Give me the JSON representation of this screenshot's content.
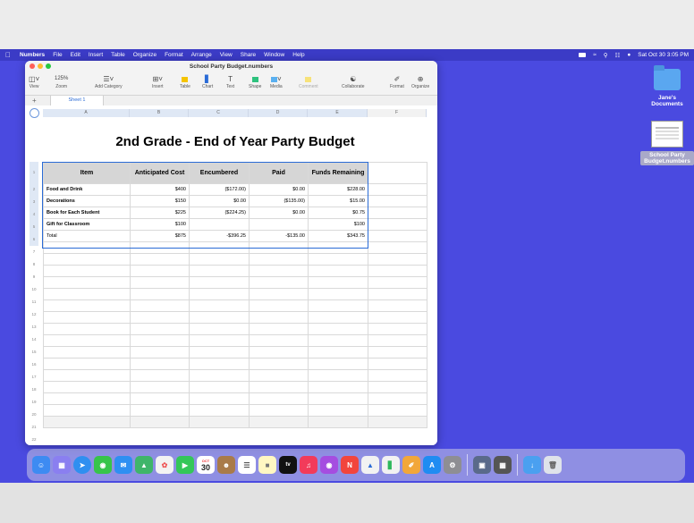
{
  "menubar": {
    "items": [
      "Numbers",
      "File",
      "Edit",
      "Insert",
      "Table",
      "Organize",
      "Format",
      "Arrange",
      "View",
      "Share",
      "Window",
      "Help"
    ],
    "datetime": "Sat Oct 30  3:05 PM"
  },
  "window": {
    "title": "School Party Budget.numbers",
    "toolbar": {
      "view": "View",
      "zoom_value": "125%",
      "zoom": "Zoom",
      "add_category": "Add Category",
      "insert": "Insert",
      "table": "Table",
      "chart": "Chart",
      "text": "Text",
      "shape": "Shape",
      "media": "Media",
      "comment": "Comment",
      "collaborate": "Collaborate",
      "format": "Format",
      "organize": "Organize"
    },
    "sheet_tab": "Sheet 1",
    "columns": [
      "A",
      "B",
      "C",
      "D",
      "E",
      "F"
    ],
    "rows": [
      "1",
      "2",
      "3",
      "4",
      "5",
      "6",
      "7",
      "8",
      "9",
      "10",
      "11",
      "12",
      "13",
      "14",
      "15",
      "16",
      "17",
      "18",
      "19",
      "20",
      "21",
      "22"
    ]
  },
  "sheet": {
    "title": "2nd Grade - End of Year Party Budget",
    "headers": [
      "Item",
      "Anticipated Cost",
      "Encumbered",
      "Paid",
      "Funds Remaining"
    ],
    "data_rows": [
      [
        "Food  and Drink",
        "$400",
        "($172.00)",
        "$0.00",
        "$228.00"
      ],
      [
        "Decorations",
        "$150",
        "$0.00",
        "($135.00)",
        "$15.00"
      ],
      [
        "Book for Each Student",
        "$225",
        "($224.25)",
        "$0.00",
        "$0.75"
      ],
      [
        "Gift for Classroom",
        "$100",
        "",
        "",
        "$100"
      ],
      [
        "Total",
        "$875",
        "-$396.25",
        "-$135.00",
        "$343.75"
      ]
    ]
  },
  "desktop": {
    "folder_label": "Jane's Documents",
    "file_label": "School Party Budget.numbers"
  },
  "dock": {
    "calendar_day": "30",
    "calendar_month": "OCT",
    "tv_label": "tv"
  },
  "colors": {
    "desktop": "#4a4ae0",
    "accent": "#2a6bd6"
  }
}
